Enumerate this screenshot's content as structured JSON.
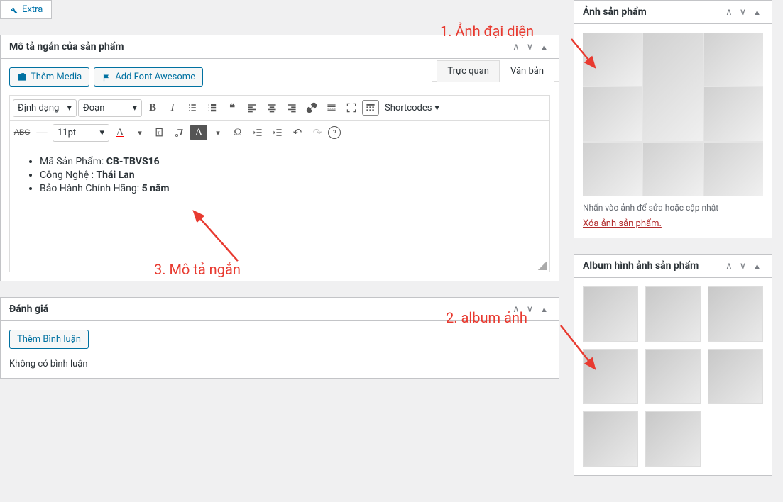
{
  "sidebar_tab": "Extra",
  "short_desc_panel": {
    "title": "Mô tả ngắn của sản phẩm",
    "add_media": "Thêm Media",
    "add_font_awesome": "Add Font Awesome",
    "tab_visual": "Trực quan",
    "tab_text": "Văn bản",
    "format_select": "Định dạng",
    "paragraph_select": "Đoạn",
    "shortcodes": "Shortcodes",
    "font_size": "11pt",
    "abc_label": "ABC",
    "content": {
      "line1_label": "Mã Sản Phẩm: ",
      "line1_value": "CB-TBVS16",
      "line2_label": "Công Nghệ : ",
      "line2_value": "Thái Lan",
      "line3_label": "Bảo Hành Chính Hãng: ",
      "line3_value": "5 năm"
    }
  },
  "reviews_panel": {
    "title": "Đánh giá",
    "add_comment": "Thêm Bình luận",
    "no_comments": "Không có bình luận"
  },
  "featured_image_panel": {
    "title": "Ảnh sản phẩm",
    "helper": "Nhấn vào ảnh để sửa hoặc cập nhật",
    "remove": "Xóa ảnh sản phẩm."
  },
  "gallery_panel": {
    "title": "Album hình ảnh sản phẩm"
  },
  "annotations": {
    "a1": "1. Ảnh đại diện",
    "a2": "2. album ảnh",
    "a3": "3. Mô tả ngắn"
  }
}
